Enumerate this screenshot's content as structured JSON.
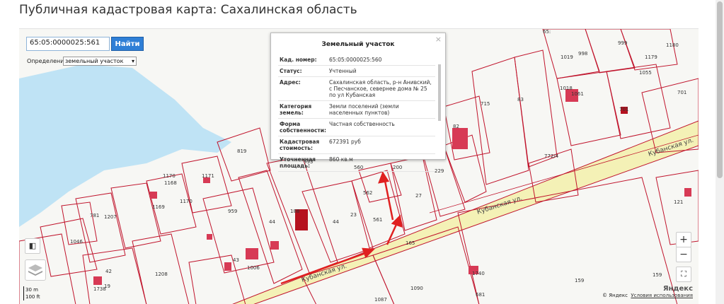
{
  "page": {
    "title": "Публичная кадастровая карта: Сахалинская область"
  },
  "search": {
    "value": "65:05:0000025:561",
    "button_label": "Найти"
  },
  "definition": {
    "label": "Определение:",
    "selected": "земельный участок"
  },
  "popup": {
    "title": "Земельный участок",
    "close": "×",
    "rows": [
      {
        "key": "Кад. номер:",
        "value": "65:05:0000025:560"
      },
      {
        "key": "Статус:",
        "value": "Учтенный"
      },
      {
        "key": "Адрес:",
        "value": "Сахалинская область, р-н Анивский, с Песчанское, севернее дома № 25 по ул Кубанская"
      },
      {
        "key": "Категория земель:",
        "value": "Земли поселений (земли населенных пунктов)"
      },
      {
        "key": "Форма собственности:",
        "value": "Частная собственность"
      },
      {
        "key": "Кадастровая стоимость:",
        "value": "672391 руб"
      },
      {
        "key": "Уточненная площадь:",
        "value": "860 кв.м"
      }
    ]
  },
  "map": {
    "streets": [
      "Кубанская ул.",
      "Кубанская ул.",
      "Кубанская ул."
    ],
    "parcel_labels": [
      "819",
      "1171",
      "1170",
      "1169",
      "1207",
      "781",
      "1046",
      "1168",
      "959",
      "1170",
      "44",
      "188",
      "44",
      "23",
      "560",
      "562",
      "561",
      "200",
      "27",
      "229",
      "993",
      "715",
      "83",
      "82",
      "772/4",
      "1019",
      "998",
      "999",
      "1179",
      "1180",
      "1018",
      "701",
      "121",
      "165",
      "42",
      "1208",
      "1738",
      "19",
      "43",
      "1006",
      "1090",
      "1087",
      "681",
      "159",
      "1740",
      "159",
      "65:",
      "1061",
      "701",
      "1055"
    ],
    "scale": {
      "metric": "30 m",
      "imperial": "100 ft"
    },
    "zoom_in": "+",
    "zoom_out": "−",
    "fullscreen": "⛶",
    "brand": "Яндекс",
    "attribution": "© Яндекс",
    "terms": "Условия использования"
  },
  "colors": {
    "parcel_line": "#c0142c",
    "water": "#bfe3f5",
    "road": "#f4f1b6",
    "building": "#d73a55",
    "arrow": "#e02020"
  }
}
